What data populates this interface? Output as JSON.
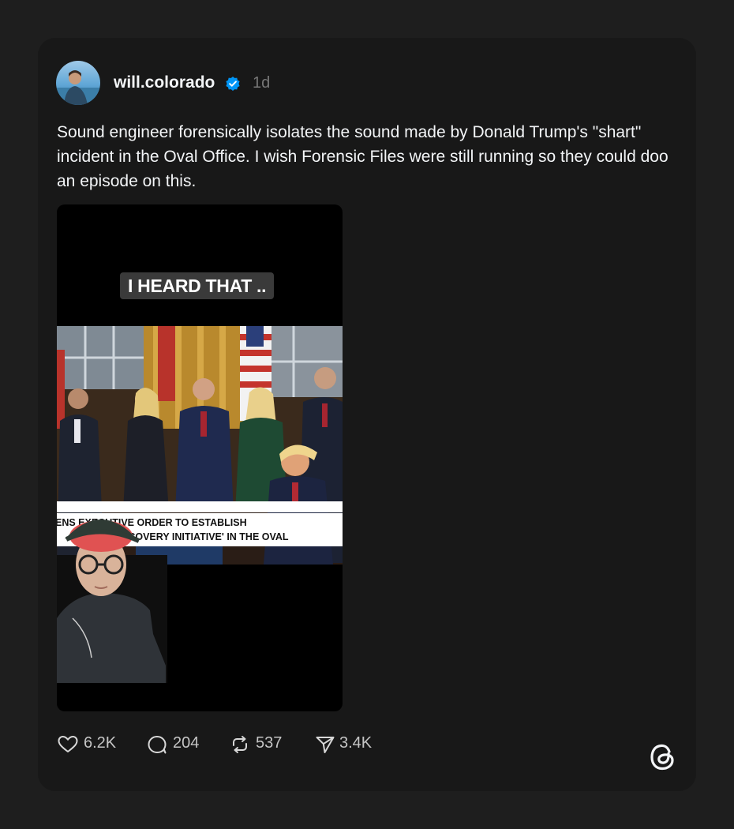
{
  "post": {
    "username": "will.colorado",
    "time": "1d",
    "caption": "Sound engineer forensically isolates the sound made by Donald Trump's \"shart\" incident in the Oval Office. I wish Forensic Files were still running so they could doo an episode on this.",
    "media": {
      "overlay_text": "I HEARD THAT ..",
      "chyron_line1": "ENS EXECUTIVE ORDER TO ESTABLISH",
      "chyron_line2": "ECOVERY INITIATIVE' IN THE OVAL"
    },
    "actions": {
      "likes": "6.2K",
      "replies": "204",
      "reposts": "537",
      "shares": "3.4K"
    }
  },
  "colors": {
    "page_bg": "#1e1e1e",
    "card_bg": "#181818",
    "verified": "#0095f6",
    "muted": "#777777"
  },
  "icons": [
    "heart-icon",
    "comment-icon",
    "repost-icon",
    "share-icon",
    "verified-badge-icon",
    "threads-logo-icon"
  ]
}
